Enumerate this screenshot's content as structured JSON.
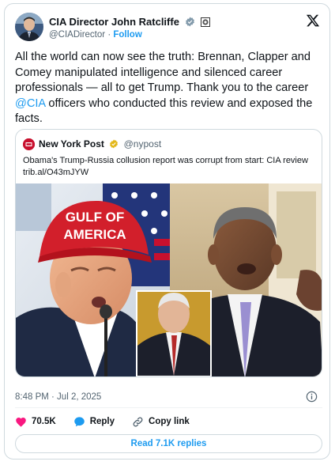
{
  "author": {
    "name": "CIA Director John Ratcliffe",
    "handle": "@CIADirector",
    "separator": "·",
    "follow_label": "Follow",
    "verified_icon": "verified-badge-icon",
    "affiliation_icon": "government-seal-icon"
  },
  "tweet": {
    "text_before": "All the world can now see the truth: Brennan, Clapper and Comey manipulated intelligence and silenced career professionals — all to get Trump. Thank you to the career ",
    "mention": "@CIA",
    "text_after": " officers who conducted this review and exposed the facts."
  },
  "quote": {
    "name": "New York Post",
    "handle": "@nypost",
    "text": "Obama's Trump-Russia collusion report was corrupt from start: CIA review",
    "link": "trib.al/O43mJYW",
    "hat_line1": "GULF OF",
    "hat_line2": "AMERICA"
  },
  "meta": {
    "timestamp": "8:48 PM · Jul 2, 2025"
  },
  "actions": {
    "likes": "70.5K",
    "reply_label": "Reply",
    "copy_label": "Copy link",
    "read_replies": "Read 7.1K replies"
  },
  "colors": {
    "accent": "#1d9bf0",
    "like": "#f91880",
    "text": "#0f1419",
    "muted": "#536471"
  }
}
